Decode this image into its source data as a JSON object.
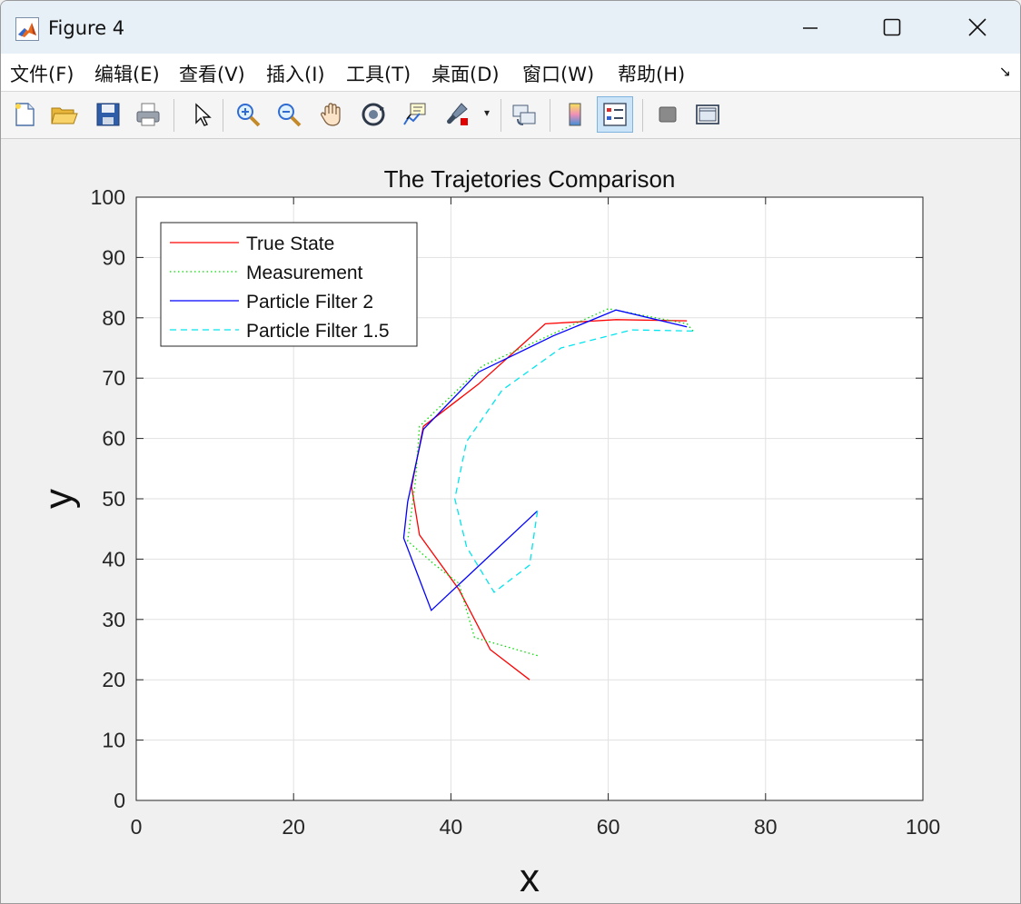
{
  "window": {
    "title": "Figure 4",
    "icon": "matlab-icon",
    "controls": [
      "minimize-icon",
      "maximize-icon",
      "close-icon"
    ]
  },
  "menu": {
    "items": [
      {
        "label": "文件(F)"
      },
      {
        "label": "编辑(E)"
      },
      {
        "label": "查看(V)"
      },
      {
        "label": "插入(I)"
      },
      {
        "label": "工具(T)"
      },
      {
        "label": "桌面(D)"
      },
      {
        "label": "窗口(W)"
      },
      {
        "label": "帮助(H)"
      }
    ],
    "dock_arrow": "↘"
  },
  "toolbar": {
    "buttons": [
      "new-figure-icon",
      "open-file-icon",
      "save-icon",
      "print-icon",
      "select-arrow-icon",
      "zoom-in-icon",
      "zoom-out-icon",
      "pan-hand-icon",
      "rotate-3d-icon",
      "data-cursor-icon",
      "brush-icon",
      "link-plot-icon",
      "colorbar-icon",
      "legend-icon",
      "hide-plot-tools-icon",
      "show-plot-tools-icon"
    ],
    "active": "legend-icon"
  },
  "chart_data": {
    "type": "line",
    "title": "The Trajetories Comparison",
    "xlabel": "x",
    "ylabel": "y",
    "xlim": [
      0,
      100
    ],
    "ylim": [
      0,
      100
    ],
    "xticks": [
      0,
      20,
      40,
      60,
      80,
      100
    ],
    "yticks": [
      0,
      10,
      20,
      30,
      40,
      50,
      60,
      70,
      80,
      90,
      100
    ],
    "grid": true,
    "legend_position": "top-left",
    "series": [
      {
        "name": "True State",
        "color": "#ff0000",
        "style": "solid",
        "points": [
          [
            50,
            20
          ],
          [
            45,
            25
          ],
          [
            41,
            35
          ],
          [
            36,
            44
          ],
          [
            35,
            52
          ],
          [
            36.5,
            62
          ],
          [
            43.5,
            69
          ],
          [
            52,
            79
          ],
          [
            61,
            79.7
          ],
          [
            70,
            79.5
          ]
        ]
      },
      {
        "name": "Measurement",
        "color": "#00dd00",
        "style": "dotted",
        "points": [
          [
            51,
            24
          ],
          [
            43,
            27
          ],
          [
            41,
            36
          ],
          [
            38,
            39
          ],
          [
            34.5,
            43
          ],
          [
            35.5,
            53
          ],
          [
            36,
            62
          ],
          [
            44,
            72
          ],
          [
            49,
            75
          ],
          [
            60,
            81.5
          ],
          [
            70,
            79
          ],
          [
            71,
            77.5
          ]
        ]
      },
      {
        "name": "Particle Filter 2",
        "color": "#0000ff",
        "style": "solid",
        "points": [
          [
            51,
            48
          ],
          [
            37.5,
            31.5
          ],
          [
            34,
            43.5
          ],
          [
            34.5,
            49.5
          ],
          [
            36.5,
            61.5
          ],
          [
            43.5,
            71
          ],
          [
            53,
            77
          ],
          [
            61,
            81.3
          ],
          [
            70,
            78.5
          ]
        ]
      },
      {
        "name": "Particle Filter 1.5",
        "color": "#00e5ee",
        "style": "dashed",
        "points": [
          [
            51,
            48
          ],
          [
            50,
            39
          ],
          [
            45.5,
            34.5
          ],
          [
            42,
            42
          ],
          [
            40.5,
            50
          ],
          [
            42,
            59.5
          ],
          [
            46.5,
            68
          ],
          [
            54,
            75
          ],
          [
            63,
            78
          ],
          [
            71,
            77.8
          ]
        ]
      }
    ]
  }
}
